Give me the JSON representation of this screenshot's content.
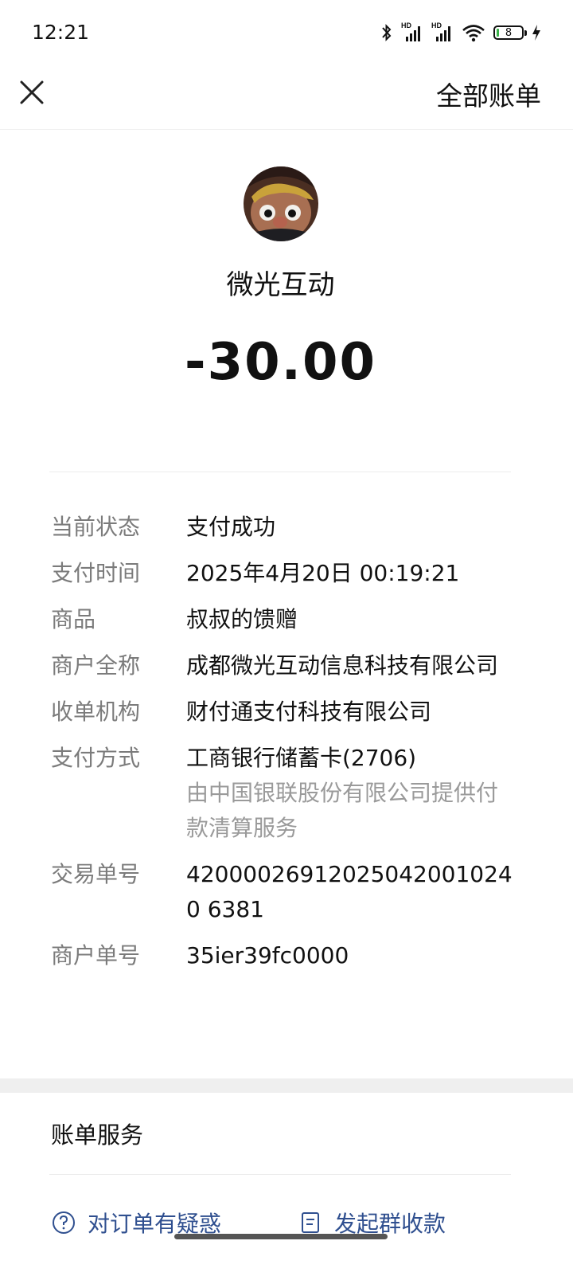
{
  "status_bar": {
    "time": "12:21",
    "signal_label_1": "HD",
    "signal_label_2": "HD",
    "battery_level": "8",
    "icons": [
      "bluetooth-icon",
      "signal-icon",
      "signal-icon",
      "wifi-icon",
      "battery-icon",
      "charging-icon"
    ]
  },
  "nav": {
    "close_icon": "close-icon",
    "all_bills_label": "全部账单"
  },
  "transaction": {
    "merchant_name": "微光互动",
    "amount": "-30.00"
  },
  "details": {
    "status_label": "当前状态",
    "status_value": "支付成功",
    "time_label": "支付时间",
    "time_value": "2025年4月20日 00:19:21",
    "product_label": "商品",
    "product_value": "叔叔的馈赠",
    "merchant_full_label": "商户全称",
    "merchant_full_value": "成都微光互动信息科技有限公司",
    "acquirer_label": "收单机构",
    "acquirer_value": "财付通支付科技有限公司",
    "method_label": "支付方式",
    "method_value": "工商银行储蓄卡(2706)",
    "method_note": "由中国银联股份有限公司提供付款清算服务",
    "txn_id_label": "交易单号",
    "txn_id_value": "420000269120250420010240 6381",
    "merchant_order_label": "商户单号",
    "merchant_order_value": "35ier39fc0000"
  },
  "bill_services": {
    "title": "账单服务",
    "question_link": "对订单有疑惑",
    "group_collect_link": "发起群收款"
  },
  "colors": {
    "link": "#2f4f8f",
    "label_gray": "#7b7b7b",
    "band_gray": "#efefef"
  }
}
